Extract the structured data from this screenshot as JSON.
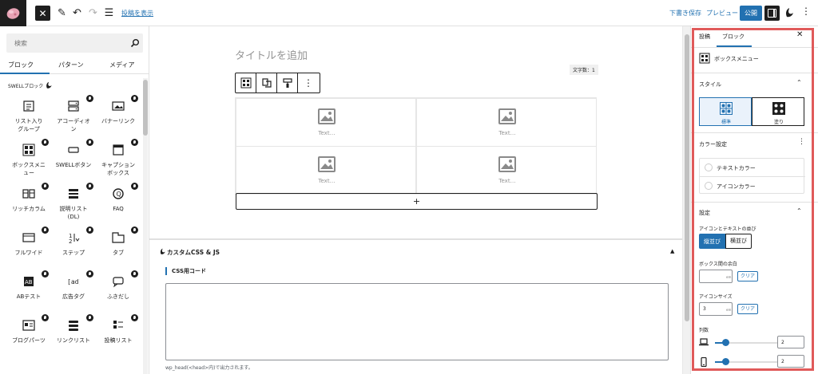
{
  "topbar": {
    "show_post_link": "投稿を表示",
    "save_draft": "下書き保存",
    "preview": "プレビュー",
    "publish": "公開"
  },
  "inserter": {
    "search_placeholder": "検索",
    "tabs": [
      "ブロック",
      "パターン",
      "メディア"
    ],
    "category_title": "SWELLブロック",
    "blocks": [
      {
        "label": "リスト入り\nグループ",
        "icon": "list-group-icon",
        "badge": false
      },
      {
        "label": "アコーディオ\nン",
        "icon": "accordion-icon",
        "badge": true
      },
      {
        "label": "バナーリンク",
        "icon": "banner-link-icon",
        "badge": true
      },
      {
        "label": "ボックスメニ\nュー",
        "icon": "box-menu-icon",
        "badge": true
      },
      {
        "label": "SWELLボタン",
        "icon": "swell-button-icon",
        "badge": true
      },
      {
        "label": "キャプション\nボックス",
        "icon": "caption-box-icon",
        "badge": true
      },
      {
        "label": "リッチカラム",
        "icon": "rich-column-icon",
        "badge": true
      },
      {
        "label": "説明リスト\n(DL)",
        "icon": "description-list-icon",
        "badge": true
      },
      {
        "label": "FAQ",
        "icon": "faq-icon",
        "badge": true
      },
      {
        "label": "フルワイド",
        "icon": "full-wide-icon",
        "badge": true
      },
      {
        "label": "ステップ",
        "icon": "step-icon",
        "badge": true
      },
      {
        "label": "タブ",
        "icon": "tab-icon",
        "badge": true
      },
      {
        "label": "ABテスト",
        "icon": "ab-test-icon",
        "badge": true
      },
      {
        "label": "広告タグ",
        "icon": "ad-tag-icon",
        "badge": true
      },
      {
        "label": "ふきだし",
        "icon": "balloon-icon",
        "badge": true
      },
      {
        "label": "ブログパーツ",
        "icon": "blog-parts-icon",
        "badge": true
      },
      {
        "label": "リンクリスト",
        "icon": "link-list-icon",
        "badge": true
      },
      {
        "label": "投稿リスト",
        "icon": "post-list-icon",
        "badge": true
      }
    ]
  },
  "editor": {
    "title_placeholder": "タイトルを追加",
    "word_count": "文字数：1",
    "cells": [
      "Text…",
      "Text…",
      "Text…",
      "Text…"
    ],
    "add_block": "+",
    "meta_title": "カスタムCSS & JS",
    "css_label": "CSS用コード",
    "css_hint": "wp_head(<head>内)で出力されます。"
  },
  "settings": {
    "tab_post": "投稿",
    "tab_block": "ブロック",
    "block_name": "ボックスメニュー",
    "style_title": "スタイル",
    "style_standard": "標準",
    "style_filled": "塗り",
    "color_title": "カラー設定",
    "text_color": "テキストカラー",
    "icon_color": "アイコンカラー",
    "settings_title": "設定",
    "align_label": "アイコンとテキストの並び",
    "align_vertical": "縦並び",
    "align_horizontal": "横並び",
    "margin_label": "ボックス間の余白",
    "margin_unit": "em",
    "clear": "クリア",
    "icon_size_label": "アイコンサイズ",
    "icon_size_value": "3",
    "icon_size_unit": "em",
    "columns_label": "列数",
    "columns_pc": {
      "value": "2",
      "fraction": 0.17
    },
    "columns_mobile": {
      "value": "2",
      "fraction": 0.17
    }
  },
  "colors": {
    "accent": "#2271b1",
    "highlight": "#e05a5a"
  }
}
